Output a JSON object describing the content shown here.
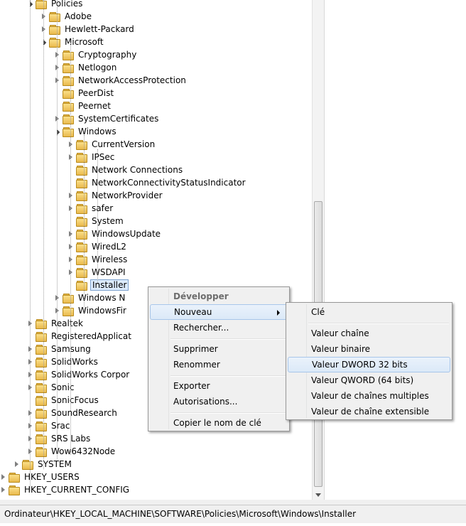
{
  "tree": {
    "nodes": [
      {
        "label": "Policies",
        "exp": "o"
      },
      {
        "label": "Adobe",
        "exp": "c"
      },
      {
        "label": "Hewlett-Packard",
        "exp": "c"
      },
      {
        "label": "Microsoft",
        "exp": "o"
      },
      {
        "label": "Cryptography",
        "exp": "c"
      },
      {
        "label": "Netlogon",
        "exp": "c"
      },
      {
        "label": "NetworkAccessProtection",
        "exp": "c"
      },
      {
        "label": "PeerDist",
        "exp": "n"
      },
      {
        "label": "Peernet",
        "exp": "n"
      },
      {
        "label": "SystemCertificates",
        "exp": "c"
      },
      {
        "label": "Windows",
        "exp": "o"
      },
      {
        "label": "CurrentVersion",
        "exp": "c"
      },
      {
        "label": "IPSec",
        "exp": "c"
      },
      {
        "label": "Network Connections",
        "exp": "n"
      },
      {
        "label": "NetworkConnectivityStatusIndicator",
        "exp": "n"
      },
      {
        "label": "NetworkProvider",
        "exp": "c"
      },
      {
        "label": "safer",
        "exp": "c"
      },
      {
        "label": "System",
        "exp": "n"
      },
      {
        "label": "WindowsUpdate",
        "exp": "c"
      },
      {
        "label": "WiredL2",
        "exp": "c"
      },
      {
        "label": "Wireless",
        "exp": "c"
      },
      {
        "label": "WSDAPI",
        "exp": "c"
      },
      {
        "label": "Installer",
        "exp": "n",
        "selected": true
      },
      {
        "label": "Windows N",
        "exp": "c"
      },
      {
        "label": "WindowsFir",
        "exp": "c"
      },
      {
        "label": "Realtek",
        "exp": "c"
      },
      {
        "label": "RegisteredApplicat",
        "exp": "n"
      },
      {
        "label": "Samsung",
        "exp": "c"
      },
      {
        "label": "SolidWorks",
        "exp": "c"
      },
      {
        "label": "SolidWorks Corpor",
        "exp": "c"
      },
      {
        "label": "Sonic",
        "exp": "c"
      },
      {
        "label": "SonicFocus",
        "exp": "n"
      },
      {
        "label": "SoundResearch",
        "exp": "c"
      },
      {
        "label": "Srac",
        "exp": "c"
      },
      {
        "label": "SRS Labs",
        "exp": "c"
      },
      {
        "label": "Wow6432Node",
        "exp": "c"
      },
      {
        "label": "SYSTEM",
        "exp": "c"
      },
      {
        "label": "HKEY_USERS",
        "exp": "c"
      },
      {
        "label": "HKEY_CURRENT_CONFIG",
        "exp": "c"
      }
    ]
  },
  "context_menu": {
    "items": [
      {
        "label": "Développer",
        "kind": "bold"
      },
      {
        "label": "Nouveau",
        "kind": "submenu"
      },
      {
        "label": "Rechercher..."
      },
      {
        "label": "Supprimer"
      },
      {
        "label": "Renommer"
      },
      {
        "label": "Exporter"
      },
      {
        "label": "Autorisations..."
      },
      {
        "label": "Copier le nom de clé"
      }
    ]
  },
  "submenu": {
    "items": [
      {
        "label": "Clé"
      },
      {
        "label": "Valeur chaîne"
      },
      {
        "label": "Valeur binaire"
      },
      {
        "label": "Valeur DWORD 32 bits",
        "highlighted": true
      },
      {
        "label": "Valeur QWORD (64 bits)"
      },
      {
        "label": "Valeur de chaînes multiples"
      },
      {
        "label": "Valeur de chaîne extensible"
      }
    ]
  },
  "statusbar": {
    "path": "Ordinateur\\HKEY_LOCAL_MACHINE\\SOFTWARE\\Policies\\Microsoft\\Windows\\Installer"
  }
}
